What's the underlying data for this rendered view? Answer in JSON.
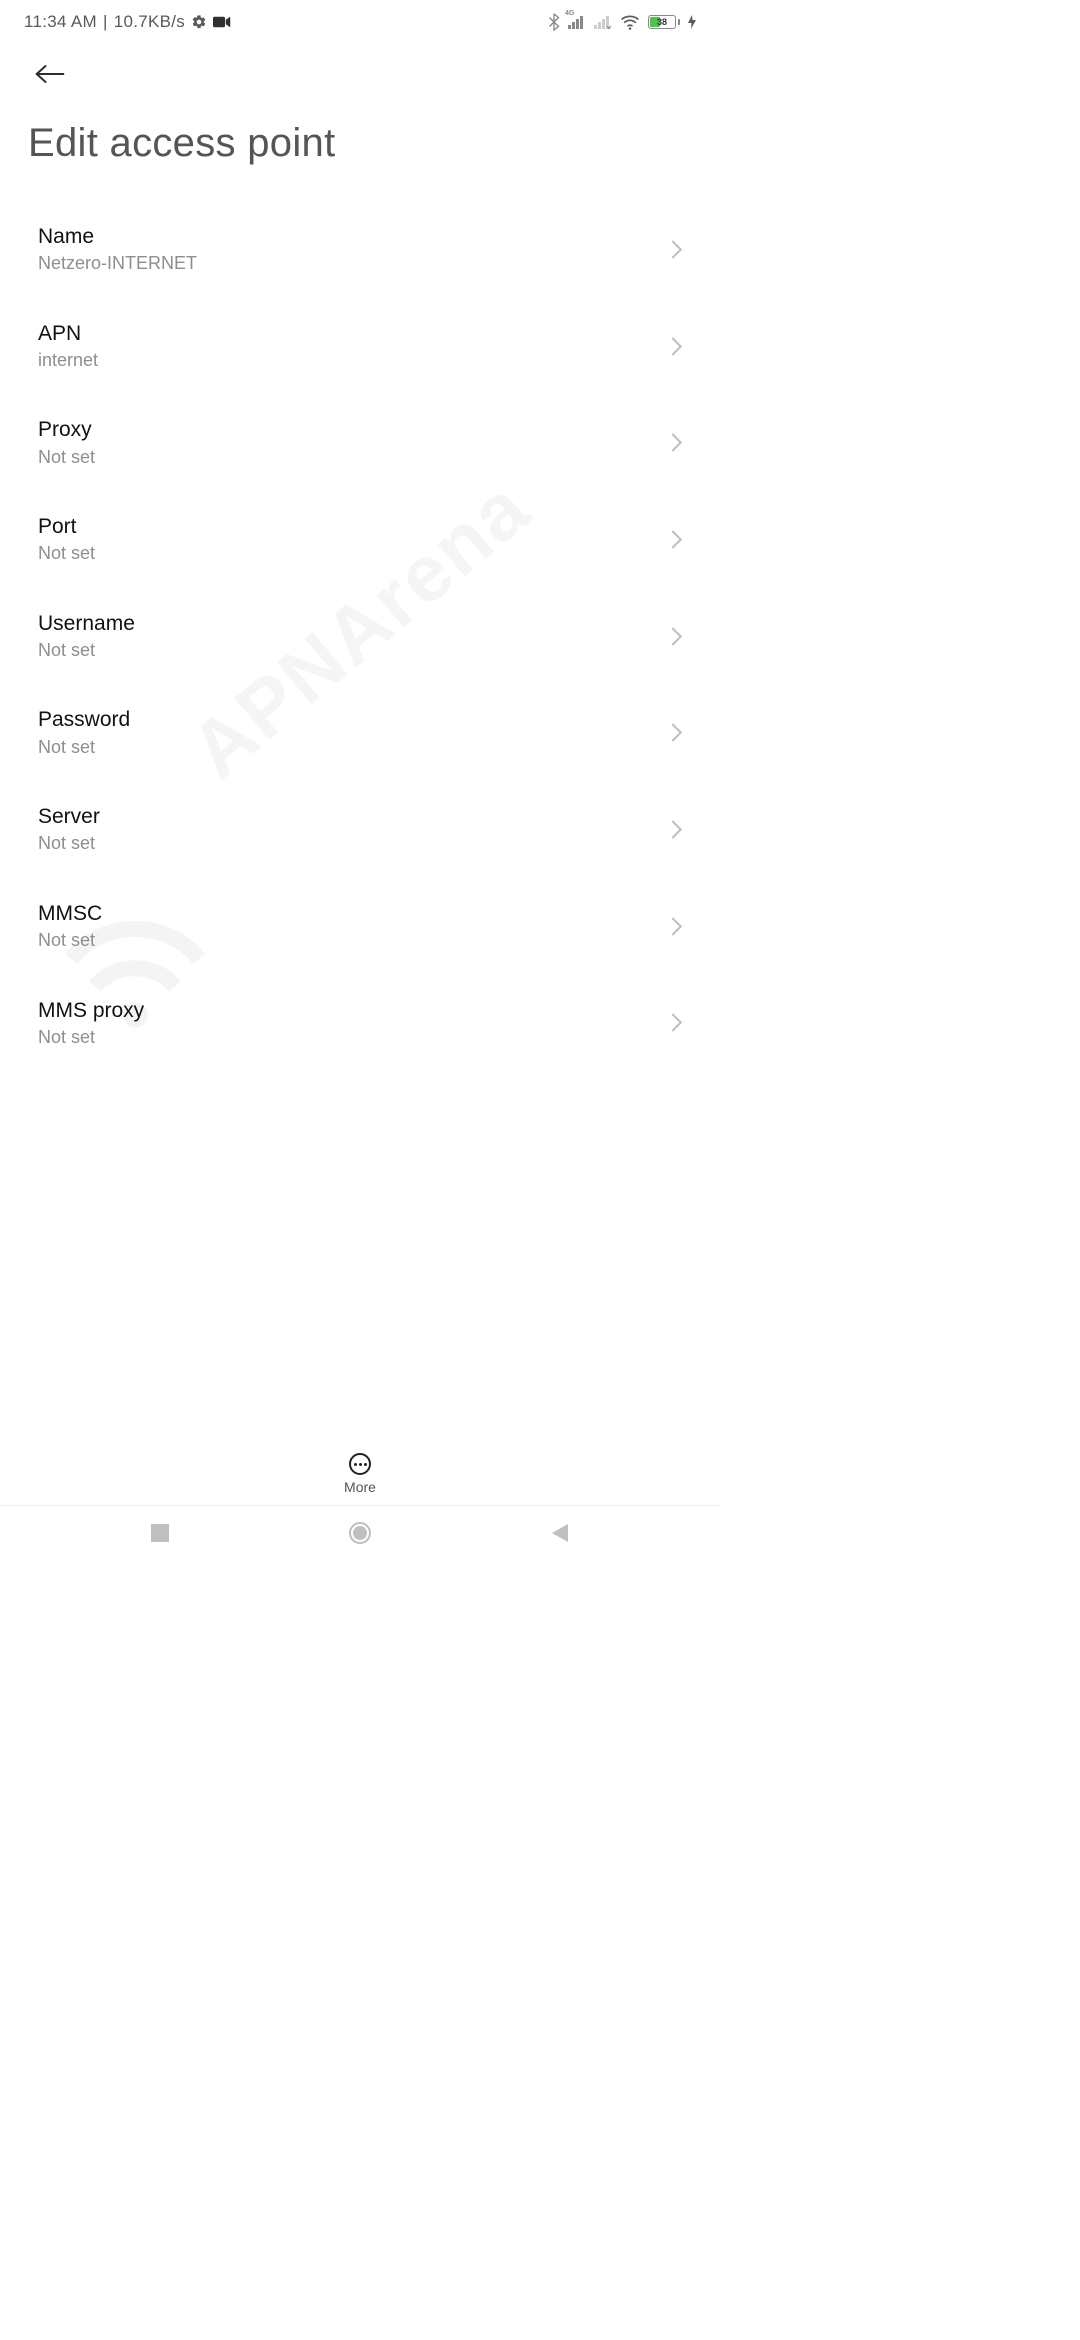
{
  "status": {
    "time": "11:34 AM",
    "speed": "10.7KB/s",
    "battery_text": "38",
    "network_badge": "4G"
  },
  "header": {
    "title": "Edit access point"
  },
  "settings": [
    {
      "label": "Name",
      "value": "Netzero-INTERNET"
    },
    {
      "label": "APN",
      "value": "internet"
    },
    {
      "label": "Proxy",
      "value": "Not set"
    },
    {
      "label": "Port",
      "value": "Not set"
    },
    {
      "label": "Username",
      "value": "Not set"
    },
    {
      "label": "Password",
      "value": "Not set"
    },
    {
      "label": "Server",
      "value": "Not set"
    },
    {
      "label": "MMSC",
      "value": "Not set"
    },
    {
      "label": "MMS proxy",
      "value": "Not set"
    }
  ],
  "bottom": {
    "more_label": "More"
  },
  "watermark": "APNArena"
}
